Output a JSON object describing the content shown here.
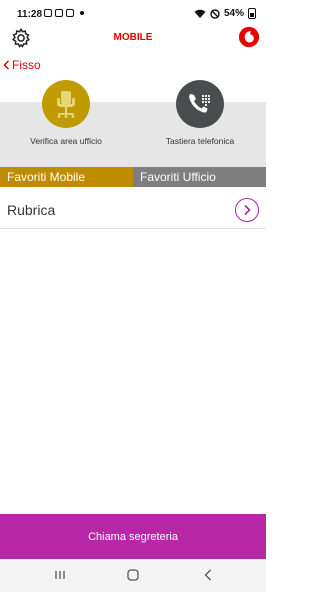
{
  "status_bar": {
    "time": "11:28",
    "battery": "54%"
  },
  "header": {
    "title": "MOBILE",
    "settings_icon": "gear-icon",
    "logo": "vodafone-logo"
  },
  "nav": {
    "back_label": "Fisso"
  },
  "actions": {
    "check_office": {
      "label": "Verifica area ufficio",
      "icon": "office-chair-icon",
      "color": "#bf9a00"
    },
    "keypad": {
      "label": "Tastiera telefonica",
      "icon": "phone-keypad-icon",
      "color": "#4a4d4e"
    }
  },
  "tabs": [
    {
      "label": "Favoriti Mobile",
      "active": true,
      "color": "#bf8c00"
    },
    {
      "label": "Favoriti Ufficio",
      "active": false,
      "color": "#7e7e7e"
    }
  ],
  "list": {
    "rubrica_label": "Rubrica"
  },
  "footer": {
    "voicemail_label": "Chiama segreteria",
    "color": "#b828a6"
  },
  "colors": {
    "brand_red": "#e60000",
    "accent_purple": "#9c2aa0"
  }
}
